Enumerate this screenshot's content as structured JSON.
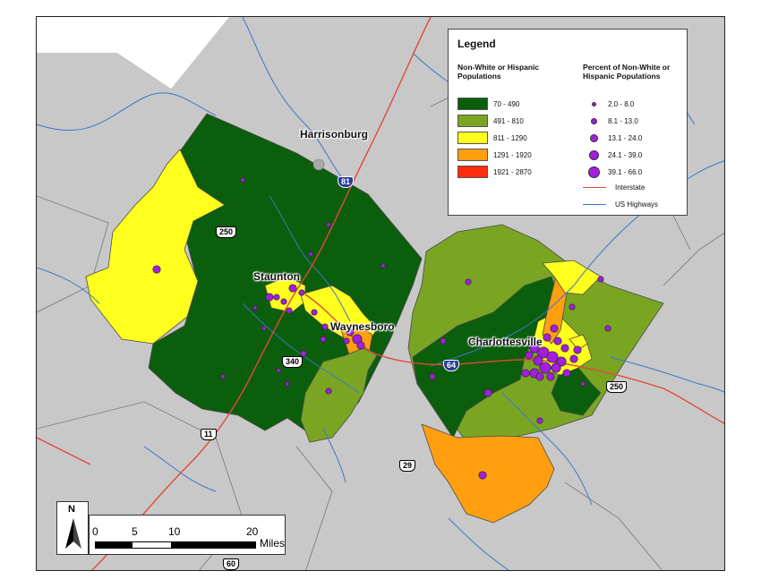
{
  "legend": {
    "title": "Legend",
    "choropleth_heading": "Non-White or Hispanic Populations",
    "classes": [
      {
        "label": "70 - 490",
        "color": "#0b5e0b"
      },
      {
        "label": "491 - 810",
        "color": "#7aa523"
      },
      {
        "label": "811 - 1290",
        "color": "#ffff1e"
      },
      {
        "label": "1291 - 1920",
        "color": "#ff9f10"
      },
      {
        "label": "1921 - 2870",
        "color": "#ff2c10"
      }
    ],
    "dots_heading": "Percent of Non-White or Hispanic Populations",
    "dots": [
      {
        "label": "2.0 - 8.0",
        "size": 1
      },
      {
        "label": "8.1 - 13.0",
        "size": 2
      },
      {
        "label": "13.1 - 24.0",
        "size": 3
      },
      {
        "label": "24.1 - 39.0",
        "size": 4
      },
      {
        "label": "39.1 - 66.0",
        "size": 5
      }
    ],
    "lines": [
      {
        "label": "Interstate",
        "color": "#e04a3a"
      },
      {
        "label": "US Highways",
        "color": "#3a78c8"
      }
    ]
  },
  "cities": {
    "harrisonburg": "Harrisonburg",
    "staunton": "Staunton",
    "waynesboro": "Waynesboro",
    "charlottesville": "Charlottesville"
  },
  "shields": {
    "i81": "81",
    "i64": "64",
    "us250_west": "250",
    "us250_east": "250",
    "us340": "340",
    "us11": "11",
    "us29": "29",
    "us60": "60"
  },
  "north_label": "N",
  "scale": {
    "ticks": [
      "0",
      "5",
      "10",
      "20"
    ],
    "units": "Miles"
  },
  "colors": {
    "background_land": "#c8c8c8",
    "outside_area": "#ffffff",
    "river": "#3a78c8",
    "interstate": "#e04a3a",
    "dot_fill": "#a21ee0"
  }
}
